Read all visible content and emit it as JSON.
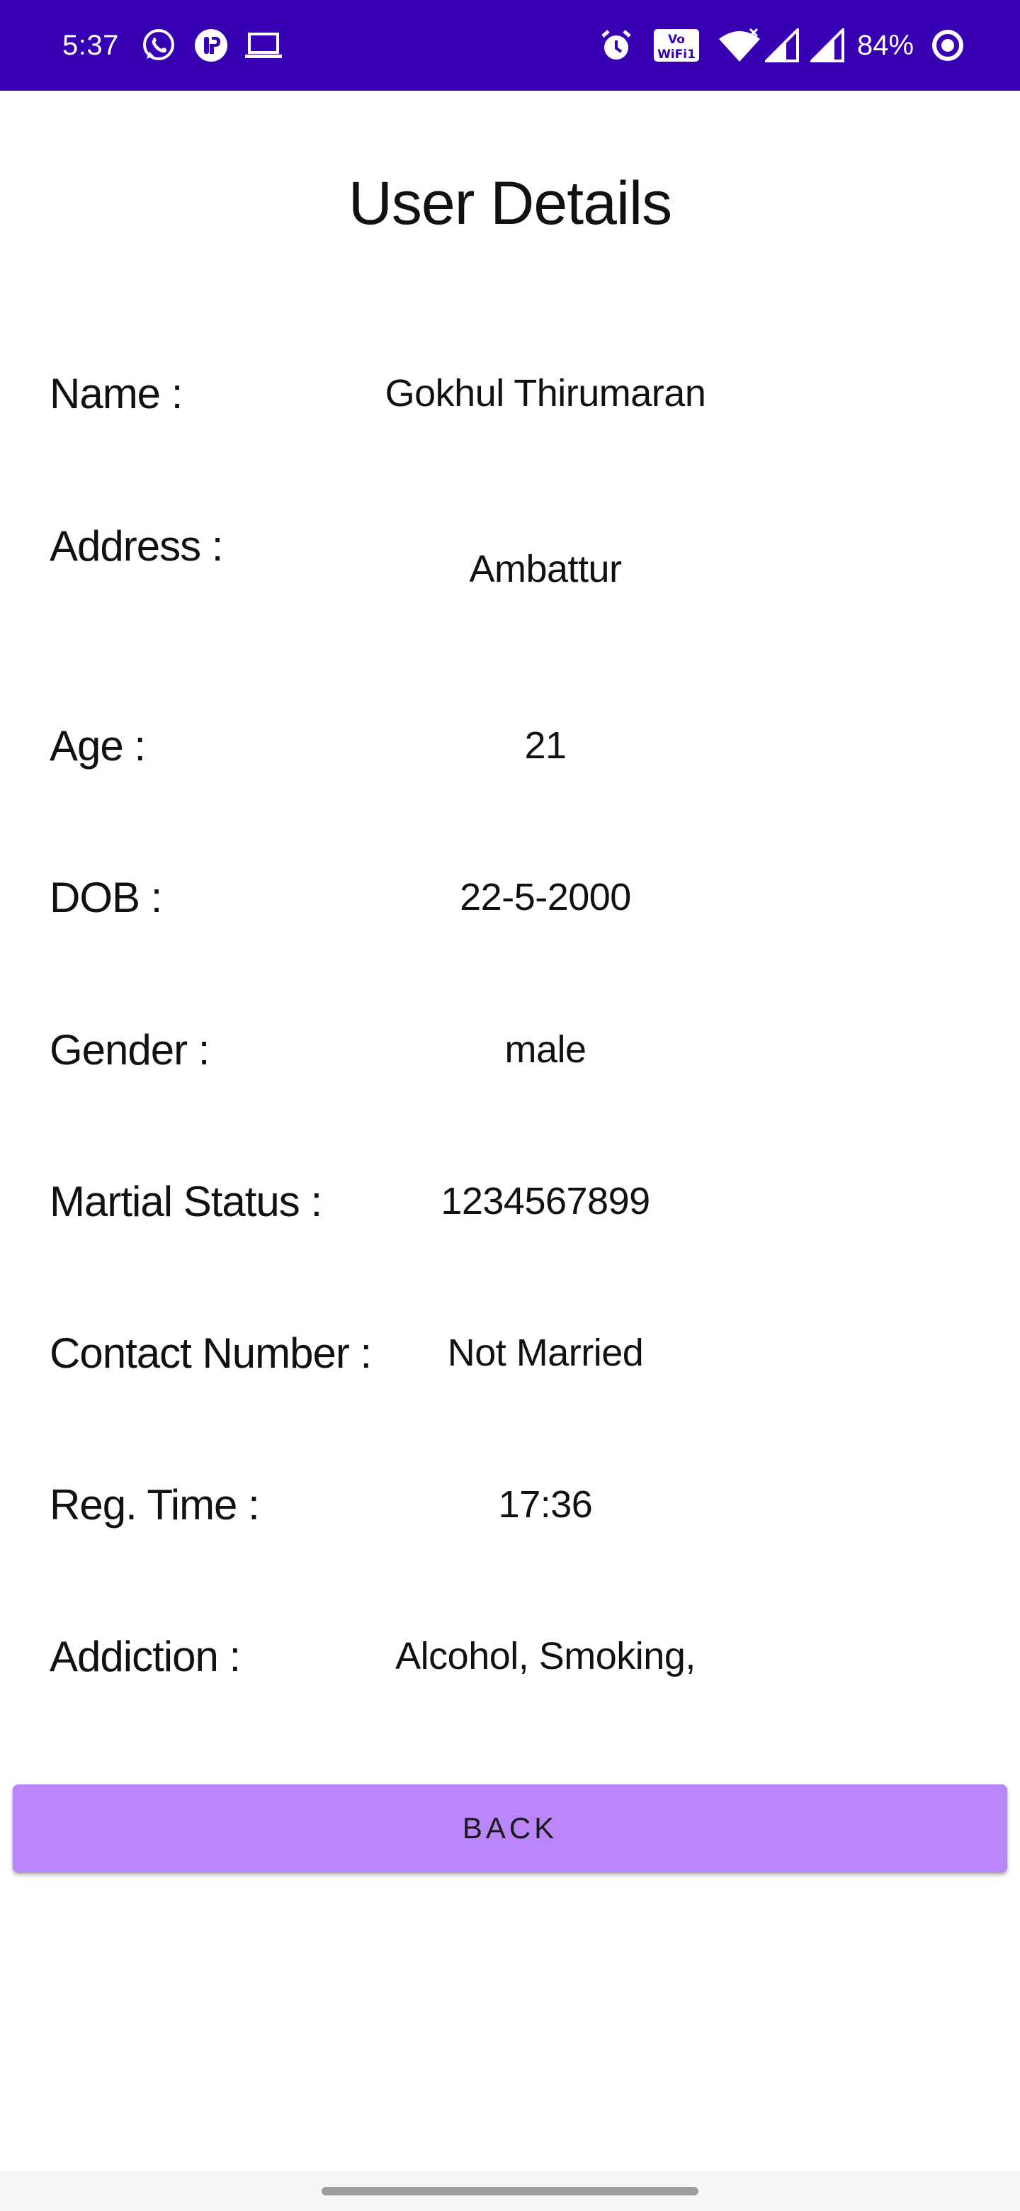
{
  "status_bar": {
    "time": "5:37",
    "battery": "84%",
    "background_color": "#3700b3",
    "icons_left": [
      "whatsapp-icon",
      "app-icon",
      "laptop-icon"
    ],
    "icons_right": [
      "alarm-icon",
      "vowifi-icon",
      "wifi-icon",
      "signal-icon",
      "signal-icon",
      "battery-ring-icon"
    ]
  },
  "header": {
    "title": "User Details"
  },
  "details": [
    {
      "label": "Name :",
      "value": "Gokhul Thirumaran"
    },
    {
      "label": "Address :",
      "value": "Ambattur"
    },
    {
      "label": "Age :",
      "value": "21"
    },
    {
      "label": "DOB :",
      "value": "22-5-2000"
    },
    {
      "label": "Gender :",
      "value": "male"
    },
    {
      "label": "Martial Status :",
      "value": "1234567899"
    },
    {
      "label": "Contact Number :",
      "value": "Not Married"
    },
    {
      "label": "Reg. Time :",
      "value": "17:36"
    },
    {
      "label": "Addiction :",
      "value": "Alcohol, Smoking,"
    }
  ],
  "actions": {
    "back_label": "BACK",
    "back_color": "#bb86fc"
  }
}
